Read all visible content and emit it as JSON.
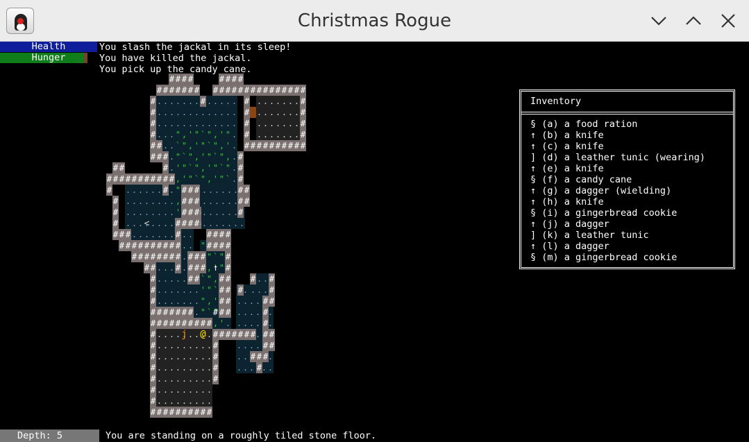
{
  "window": {
    "title": "Christmas Rogue",
    "icon": "java-duke-icon"
  },
  "stats": {
    "health": {
      "label": "Health",
      "fraction": 1.0,
      "color": "#0f1f9c"
    },
    "hunger": {
      "label": "Hunger",
      "fraction": 0.86,
      "color": "#0e7d1a"
    }
  },
  "messages": [
    "You slash the jackal in its sleep!",
    "You have killed the jackal.",
    "You pick up the candy cane."
  ],
  "inventory": {
    "title": "Inventory",
    "items": [
      "§ (a) a food ration",
      "↑ (b) a knife",
      "↑ (c) a knife",
      "] (d) a leather tunic (wearing)",
      "↑ (e) a knife",
      "§ (f) a candy cane",
      "↑ (g) a dagger (wielding)",
      "↑ (h) a knife",
      "§ (i) a gingerbread cookie",
      "↑ (j) a dagger",
      "] (k) a leather tunic",
      "↑ (l) a dagger",
      "§ (m) a gingerbread cookie"
    ]
  },
  "depth": "Depth: 5",
  "status": "You are standing on a roughly tiled stone floor.",
  "map": {
    "player": "@",
    "monster": "j",
    "stairs": "<",
    "colors": {
      "wall": "#ffffff",
      "wall_bg": "#7a7070",
      "floor_lit": "#222222",
      "floor_dark": "#0c2330",
      "grass": "#33cc33",
      "player": "#ffe000",
      "monster": "#ff8c00",
      "door": "#8b4513"
    }
  }
}
